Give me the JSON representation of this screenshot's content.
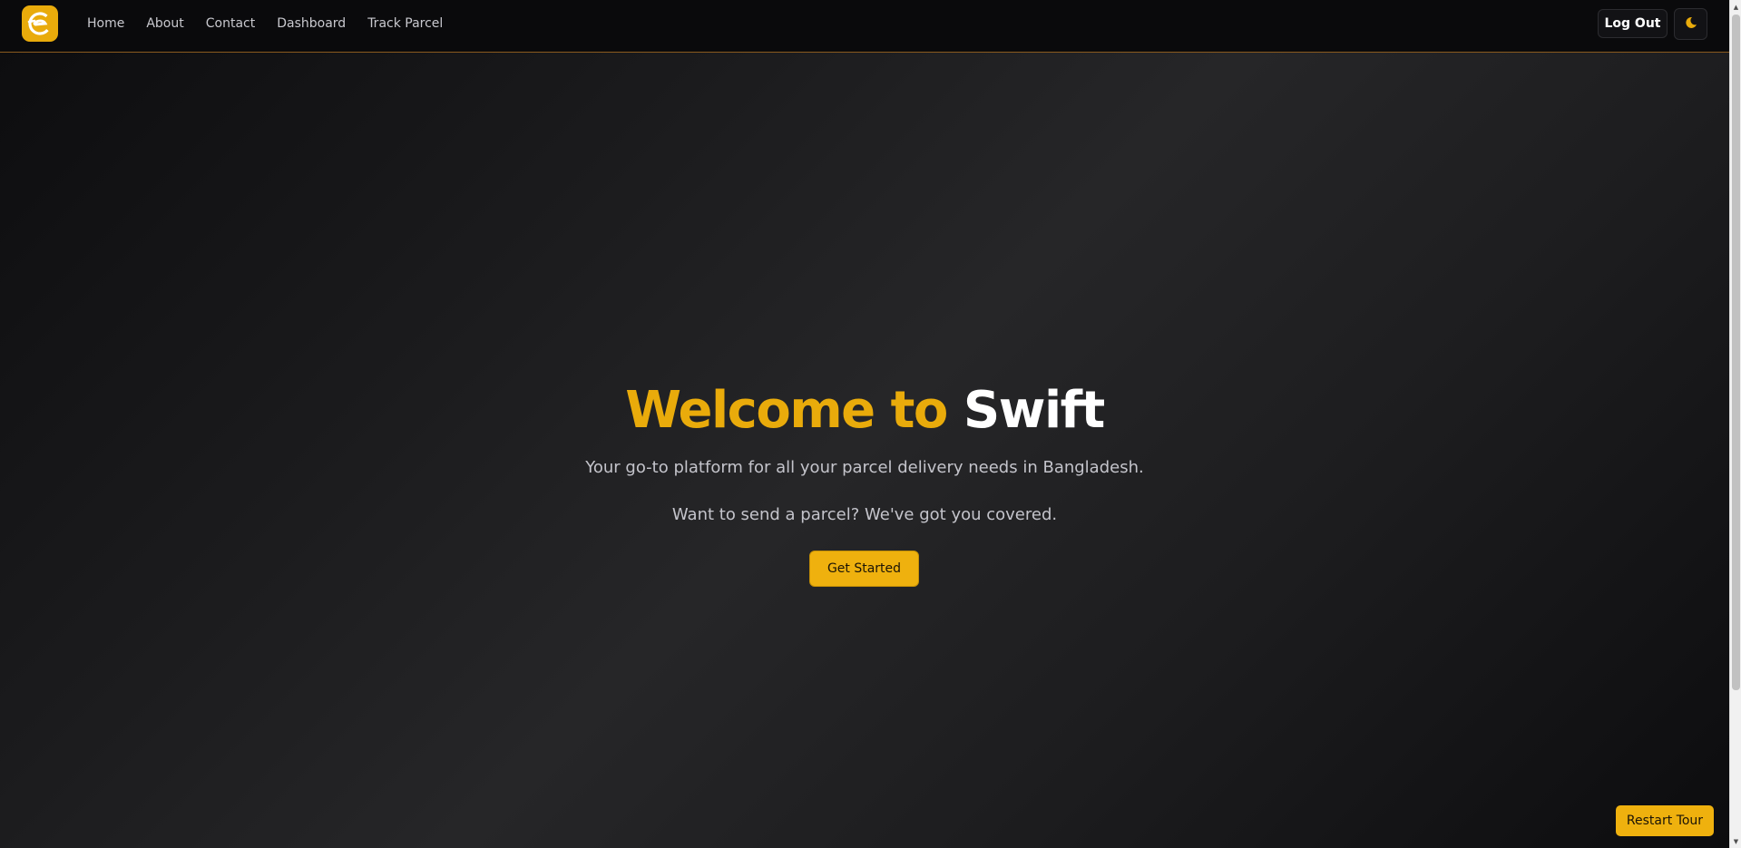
{
  "nav": {
    "logo_icon": "swift-logo-icon",
    "links": [
      "Home",
      "About",
      "Contact",
      "Dashboard",
      "Track Parcel"
    ],
    "logout_label": "Log Out",
    "theme_icon": "moon-icon"
  },
  "hero": {
    "title_accent": "Welcome to ",
    "title_brand": "Swift",
    "subtitle": "Your go-to platform for all your parcel delivery needs in Bangladesh.",
    "tagline": "Want to send a parcel? We've got you covered.",
    "cta_label": "Get Started"
  },
  "tour": {
    "restart_label": "Restart Tour"
  },
  "colors": {
    "accent": "#e9ab0b",
    "background": "#1a1a1c",
    "nav_border": "#8a5a1e"
  }
}
